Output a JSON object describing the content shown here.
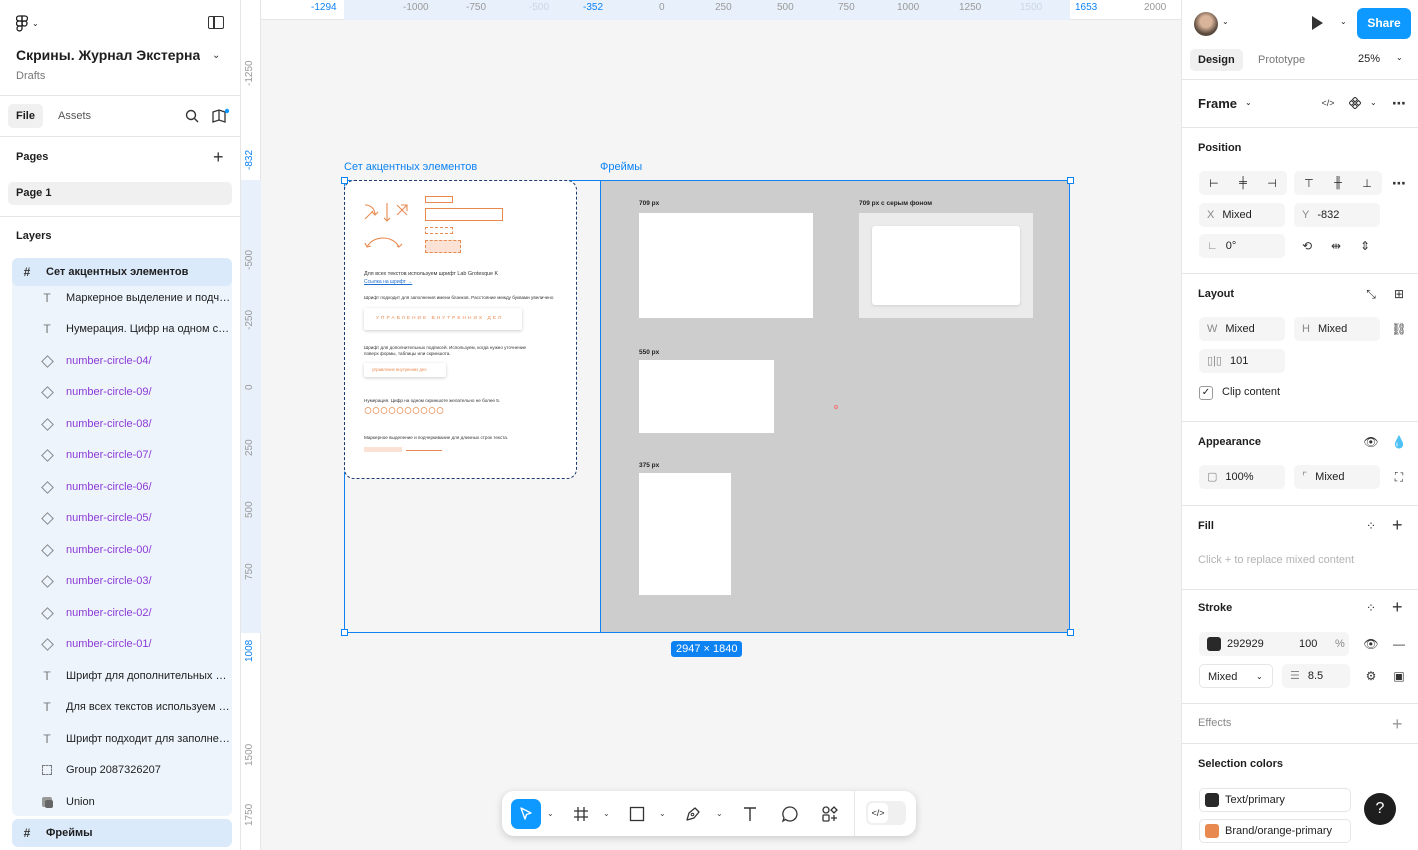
{
  "project": {
    "title": "Скрины. Журнал Экстерна...",
    "location": "Drafts"
  },
  "left_tabs": {
    "file": "File",
    "assets": "Assets"
  },
  "pages": {
    "header": "Pages",
    "items": [
      "Page 1"
    ]
  },
  "layers": {
    "header": "Layers",
    "items": [
      {
        "name": "Сет акцентных элементов",
        "kind": "frame"
      },
      {
        "name": "Маркерное выделение и подчеркивание",
        "kind": "text"
      },
      {
        "name": "Нумерация. Цифр на одном скрине",
        "kind": "text"
      },
      {
        "name": "number-circle-04/",
        "kind": "component"
      },
      {
        "name": "number-circle-09/",
        "kind": "component"
      },
      {
        "name": "number-circle-08/",
        "kind": "component"
      },
      {
        "name": "number-circle-07/",
        "kind": "component"
      },
      {
        "name": "number-circle-06/",
        "kind": "component"
      },
      {
        "name": "number-circle-05/",
        "kind": "component"
      },
      {
        "name": "number-circle-00/",
        "kind": "component"
      },
      {
        "name": "number-circle-03/",
        "kind": "component"
      },
      {
        "name": "number-circle-02/",
        "kind": "component"
      },
      {
        "name": "number-circle-01/",
        "kind": "component"
      },
      {
        "name": "Шрифт для дополнительных подписей",
        "kind": "text"
      },
      {
        "name": "Для всех текстов используем шрифт",
        "kind": "text"
      },
      {
        "name": "Шрифт подходит для заполнения",
        "kind": "text"
      },
      {
        "name": "Group 2087326207",
        "kind": "group"
      },
      {
        "name": "Union",
        "kind": "union"
      },
      {
        "name": "Фреймы",
        "kind": "frame"
      }
    ]
  },
  "rulers": {
    "h": [
      "-1294",
      "-1000",
      "-750",
      "-500",
      "-352",
      "0",
      "250",
      "500",
      "750",
      "1000",
      "1250",
      "1500",
      "1653",
      "2000"
    ],
    "v": [
      "-1250",
      "-832",
      "-500",
      "-250",
      "0",
      "250",
      "500",
      "750",
      "1008",
      "1500",
      "1750"
    ]
  },
  "canvas": {
    "frame1_label": "Сет акцентных элементов",
    "frame2_label": "Фреймы",
    "size_badge": "2947 × 1840",
    "card": {
      "line1": "Для всех текстов используем шрифт Lab Grotesque K",
      "link": "Ссылка на шрифт →",
      "line2": "Шрифт подходит для заполнения имени бланков. Расстояние между буквами увеличено",
      "caps_sample": "УПРАВЛЕНИЕ ВНУТРЕННИХ ДЕЛ",
      "line3": "Шрифт для дополнительных подписей. Используем, когда нужно уточнение",
      "line3b": "поверх формы, таблицы или скриншота.",
      "small_sample": "управление внутренних дел",
      "line4": "Нумерация. Цифр на одном скриншоте желательно не более 5.",
      "line5": "Маркерное выделение и подчеркивание для длинных строк текста."
    },
    "frames": [
      {
        "label": "709 px"
      },
      {
        "label": "709 px с серым фоном"
      },
      {
        "label": "550 px"
      },
      {
        "label": "375 px"
      }
    ]
  },
  "right": {
    "share": "Share",
    "tabs": {
      "design": "Design",
      "prototype": "Prototype"
    },
    "zoom": "25%",
    "frame_type": "Frame",
    "position": {
      "header": "Position",
      "x_label": "X",
      "x": "Mixed",
      "y_label": "Y",
      "y": "-832",
      "rotation": "0°"
    },
    "layout": {
      "header": "Layout",
      "w_label": "W",
      "w": "Mixed",
      "h_label": "H",
      "h": "Mixed",
      "gap": "101",
      "clip": "Clip content"
    },
    "appearance": {
      "header": "Appearance",
      "opacity": "100%",
      "radius": "Mixed"
    },
    "fill": {
      "header": "Fill",
      "hint": "Click + to replace mixed content"
    },
    "stroke": {
      "header": "Stroke",
      "color": "292929",
      "opacity": "100",
      "pct": "%",
      "position": "Mixed",
      "weight": "8.5"
    },
    "effects": {
      "header": "Effects"
    },
    "selection_colors": {
      "header": "Selection colors",
      "items": [
        {
          "name": "Text/primary",
          "color": "#292929"
        },
        {
          "name": "Brand/orange-primary",
          "color": "#e88a4f"
        }
      ]
    },
    "help": "?"
  },
  "colors": {
    "accent": "#0d99ff",
    "selection": "#0d82f3",
    "component": "#8b3ad6",
    "orange": "#e88a4f"
  }
}
